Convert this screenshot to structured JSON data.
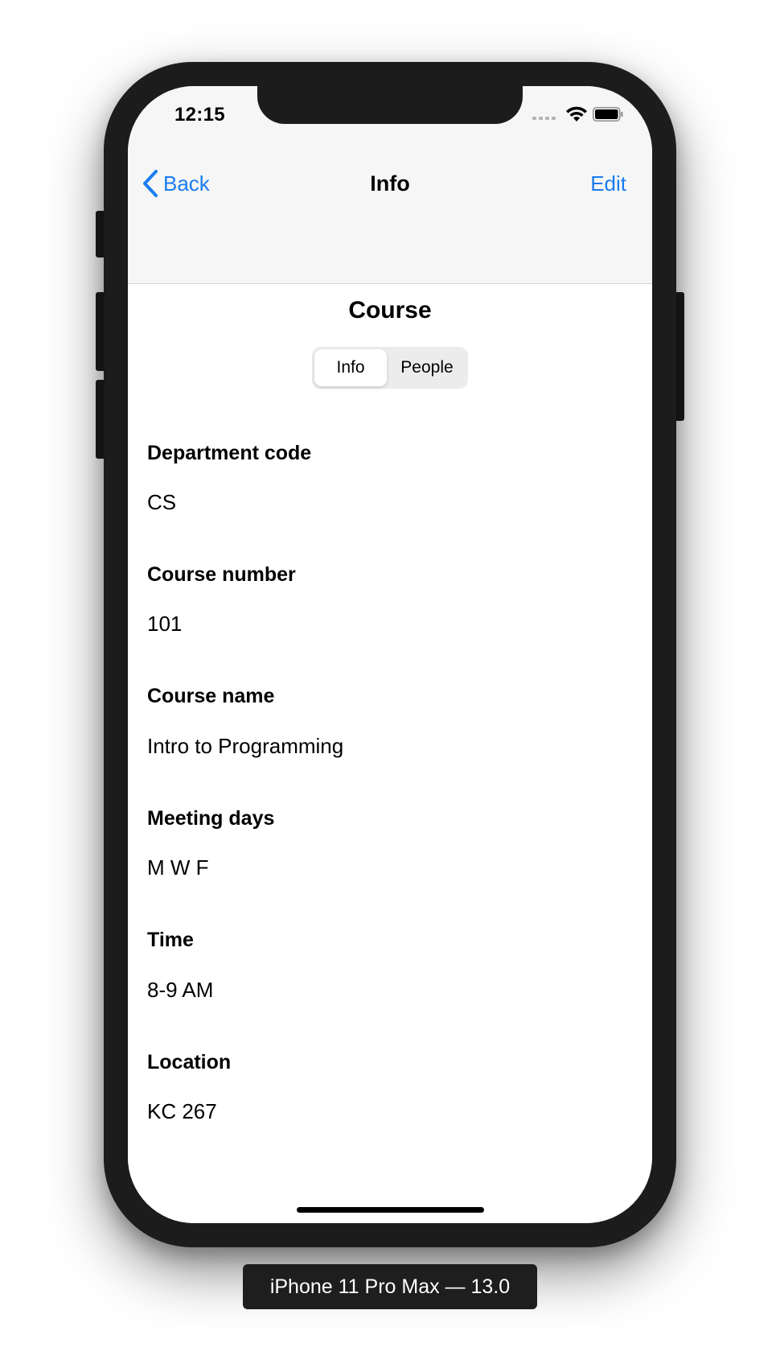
{
  "status_bar": {
    "time": "12:15"
  },
  "nav_bar": {
    "back_label": "Back",
    "title": "Info",
    "edit_label": "Edit"
  },
  "page": {
    "title": "Course",
    "segments": [
      {
        "label": "Info",
        "selected": true
      },
      {
        "label": "People",
        "selected": false
      }
    ]
  },
  "fields": [
    {
      "label": "Department code",
      "value": "CS"
    },
    {
      "label": "Course number",
      "value": "101"
    },
    {
      "label": "Course name",
      "value": "Intro to Programming"
    },
    {
      "label": "Meeting days",
      "value": "M W F"
    },
    {
      "label": "Time",
      "value": "8-9 AM"
    },
    {
      "label": "Location",
      "value": "KC 267"
    }
  ],
  "device_label": "iPhone 11 Pro Max — 13.0",
  "colors": {
    "accent": "#1a7cf0",
    "bar_background": "#f6f6f6",
    "device_frame": "#1c1c1c"
  },
  "icons": {
    "back": "chevron-left-icon",
    "wifi": "wifi-icon",
    "battery": "battery-icon",
    "signal": "cellular-signal-icon"
  }
}
